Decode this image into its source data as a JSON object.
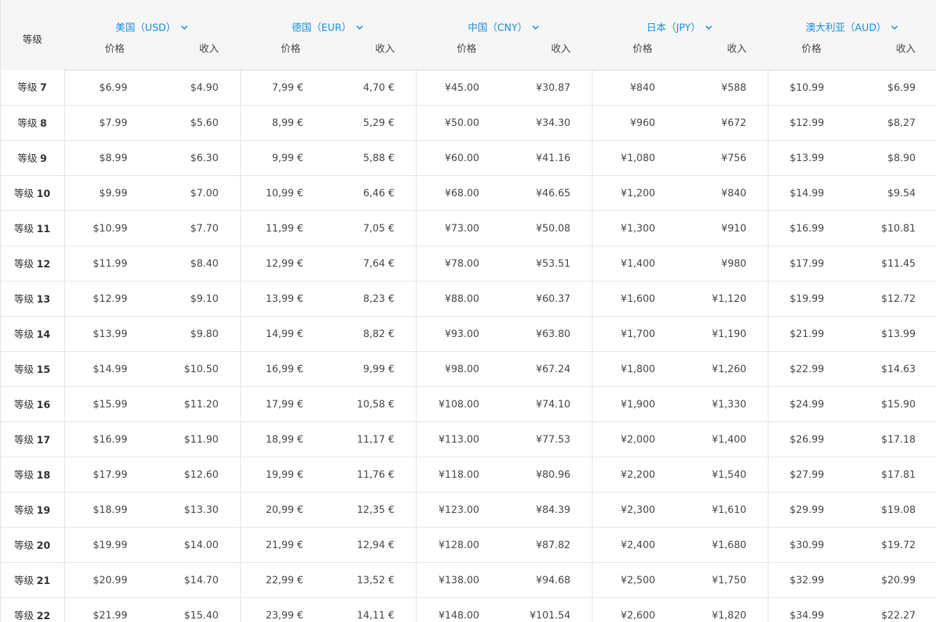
{
  "header": {
    "tier_label": "等级",
    "price_label": "价格",
    "proceeds_label": "收入",
    "currencies": [
      {
        "label": "美国（USD）"
      },
      {
        "label": "德国（EUR）"
      },
      {
        "label": "中国（CNY）"
      },
      {
        "label": "日本（JPY）"
      },
      {
        "label": "澳大利亚（AUD）"
      }
    ]
  },
  "rows": [
    {
      "tier_prefix": "等级",
      "tier_num": "7",
      "usd_p": "$6.99",
      "usd_r": "$4.90",
      "eur_p": "7,99 €",
      "eur_r": "4,70 €",
      "cny_p": "¥45.00",
      "cny_r": "¥30.87",
      "jpy_p": "¥840",
      "jpy_r": "¥588",
      "aud_p": "$10.99",
      "aud_r": "$6.99"
    },
    {
      "tier_prefix": "等级",
      "tier_num": "8",
      "usd_p": "$7.99",
      "usd_r": "$5.60",
      "eur_p": "8,99 €",
      "eur_r": "5,29 €",
      "cny_p": "¥50.00",
      "cny_r": "¥34.30",
      "jpy_p": "¥960",
      "jpy_r": "¥672",
      "aud_p": "$12.99",
      "aud_r": "$8.27"
    },
    {
      "tier_prefix": "等级",
      "tier_num": "9",
      "usd_p": "$8.99",
      "usd_r": "$6.30",
      "eur_p": "9,99 €",
      "eur_r": "5,88 €",
      "cny_p": "¥60.00",
      "cny_r": "¥41.16",
      "jpy_p": "¥1,080",
      "jpy_r": "¥756",
      "aud_p": "$13.99",
      "aud_r": "$8.90"
    },
    {
      "tier_prefix": "等级",
      "tier_num": "10",
      "usd_p": "$9.99",
      "usd_r": "$7.00",
      "eur_p": "10,99 €",
      "eur_r": "6,46 €",
      "cny_p": "¥68.00",
      "cny_r": "¥46.65",
      "jpy_p": "¥1,200",
      "jpy_r": "¥840",
      "aud_p": "$14.99",
      "aud_r": "$9.54"
    },
    {
      "tier_prefix": "等级",
      "tier_num": "11",
      "usd_p": "$10.99",
      "usd_r": "$7.70",
      "eur_p": "11,99 €",
      "eur_r": "7,05 €",
      "cny_p": "¥73.00",
      "cny_r": "¥50.08",
      "jpy_p": "¥1,300",
      "jpy_r": "¥910",
      "aud_p": "$16.99",
      "aud_r": "$10.81"
    },
    {
      "tier_prefix": "等级",
      "tier_num": "12",
      "usd_p": "$11.99",
      "usd_r": "$8.40",
      "eur_p": "12,99 €",
      "eur_r": "7,64 €",
      "cny_p": "¥78.00",
      "cny_r": "¥53.51",
      "jpy_p": "¥1,400",
      "jpy_r": "¥980",
      "aud_p": "$17.99",
      "aud_r": "$11.45"
    },
    {
      "tier_prefix": "等级",
      "tier_num": "13",
      "usd_p": "$12.99",
      "usd_r": "$9.10",
      "eur_p": "13,99 €",
      "eur_r": "8,23 €",
      "cny_p": "¥88.00",
      "cny_r": "¥60.37",
      "jpy_p": "¥1,600",
      "jpy_r": "¥1,120",
      "aud_p": "$19.99",
      "aud_r": "$12.72"
    },
    {
      "tier_prefix": "等级",
      "tier_num": "14",
      "usd_p": "$13.99",
      "usd_r": "$9.80",
      "eur_p": "14,99 €",
      "eur_r": "8,82 €",
      "cny_p": "¥93.00",
      "cny_r": "¥63.80",
      "jpy_p": "¥1,700",
      "jpy_r": "¥1,190",
      "aud_p": "$21.99",
      "aud_r": "$13.99"
    },
    {
      "tier_prefix": "等级",
      "tier_num": "15",
      "usd_p": "$14.99",
      "usd_r": "$10.50",
      "eur_p": "16,99 €",
      "eur_r": "9,99 €",
      "cny_p": "¥98.00",
      "cny_r": "¥67.24",
      "jpy_p": "¥1,800",
      "jpy_r": "¥1,260",
      "aud_p": "$22.99",
      "aud_r": "$14.63"
    },
    {
      "tier_prefix": "等级",
      "tier_num": "16",
      "usd_p": "$15.99",
      "usd_r": "$11.20",
      "eur_p": "17,99 €",
      "eur_r": "10,58 €",
      "cny_p": "¥108.00",
      "cny_r": "¥74.10",
      "jpy_p": "¥1,900",
      "jpy_r": "¥1,330",
      "aud_p": "$24.99",
      "aud_r": "$15.90"
    },
    {
      "tier_prefix": "等级",
      "tier_num": "17",
      "usd_p": "$16.99",
      "usd_r": "$11.90",
      "eur_p": "18,99 €",
      "eur_r": "11,17 €",
      "cny_p": "¥113.00",
      "cny_r": "¥77.53",
      "jpy_p": "¥2,000",
      "jpy_r": "¥1,400",
      "aud_p": "$26.99",
      "aud_r": "$17.18"
    },
    {
      "tier_prefix": "等级",
      "tier_num": "18",
      "usd_p": "$17.99",
      "usd_r": "$12.60",
      "eur_p": "19,99 €",
      "eur_r": "11,76 €",
      "cny_p": "¥118.00",
      "cny_r": "¥80.96",
      "jpy_p": "¥2,200",
      "jpy_r": "¥1,540",
      "aud_p": "$27.99",
      "aud_r": "$17.81"
    },
    {
      "tier_prefix": "等级",
      "tier_num": "19",
      "usd_p": "$18.99",
      "usd_r": "$13.30",
      "eur_p": "20,99 €",
      "eur_r": "12,35 €",
      "cny_p": "¥123.00",
      "cny_r": "¥84.39",
      "jpy_p": "¥2,300",
      "jpy_r": "¥1,610",
      "aud_p": "$29.99",
      "aud_r": "$19.08"
    },
    {
      "tier_prefix": "等级",
      "tier_num": "20",
      "usd_p": "$19.99",
      "usd_r": "$14.00",
      "eur_p": "21,99 €",
      "eur_r": "12,94 €",
      "cny_p": "¥128.00",
      "cny_r": "¥87.82",
      "jpy_p": "¥2,400",
      "jpy_r": "¥1,680",
      "aud_p": "$30.99",
      "aud_r": "$19.72"
    },
    {
      "tier_prefix": "等级",
      "tier_num": "21",
      "usd_p": "$20.99",
      "usd_r": "$14.70",
      "eur_p": "22,99 €",
      "eur_r": "13,52 €",
      "cny_p": "¥138.00",
      "cny_r": "¥94.68",
      "jpy_p": "¥2,500",
      "jpy_r": "¥1,750",
      "aud_p": "$32.99",
      "aud_r": "$20.99"
    },
    {
      "tier_prefix": "等级",
      "tier_num": "22",
      "usd_p": "$21.99",
      "usd_r": "$15.40",
      "eur_p": "23,99 €",
      "eur_r": "14,11 €",
      "cny_p": "¥148.00",
      "cny_r": "¥101.54",
      "jpy_p": "¥2,600",
      "jpy_r": "¥1,820",
      "aud_p": "$34.99",
      "aud_r": "$22.27"
    }
  ]
}
